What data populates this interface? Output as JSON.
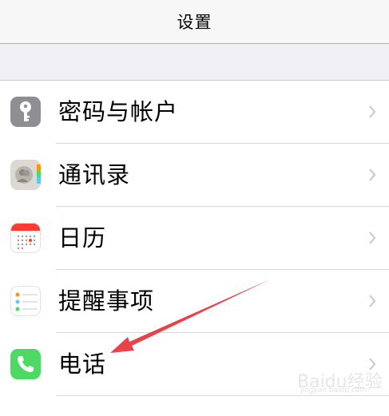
{
  "navbar": {
    "title": "设置"
  },
  "settings": {
    "items": [
      {
        "label": "密码与帐户",
        "icon": "key-icon",
        "color": "#8e8e93"
      },
      {
        "label": "通讯录",
        "icon": "contacts-icon",
        "color": "#e2e0dc"
      },
      {
        "label": "日历",
        "icon": "calendar-icon",
        "color": "#ff3b30"
      },
      {
        "label": "提醒事项",
        "icon": "reminders-icon",
        "color": "#ffffff"
      },
      {
        "label": "电话",
        "icon": "phone-icon",
        "color": "#4cd964"
      }
    ]
  },
  "watermark": {
    "text": "Baidu经验",
    "sub": "jingyan.baidu.com"
  },
  "annotation": {
    "arrow_color": "#e8434a"
  }
}
